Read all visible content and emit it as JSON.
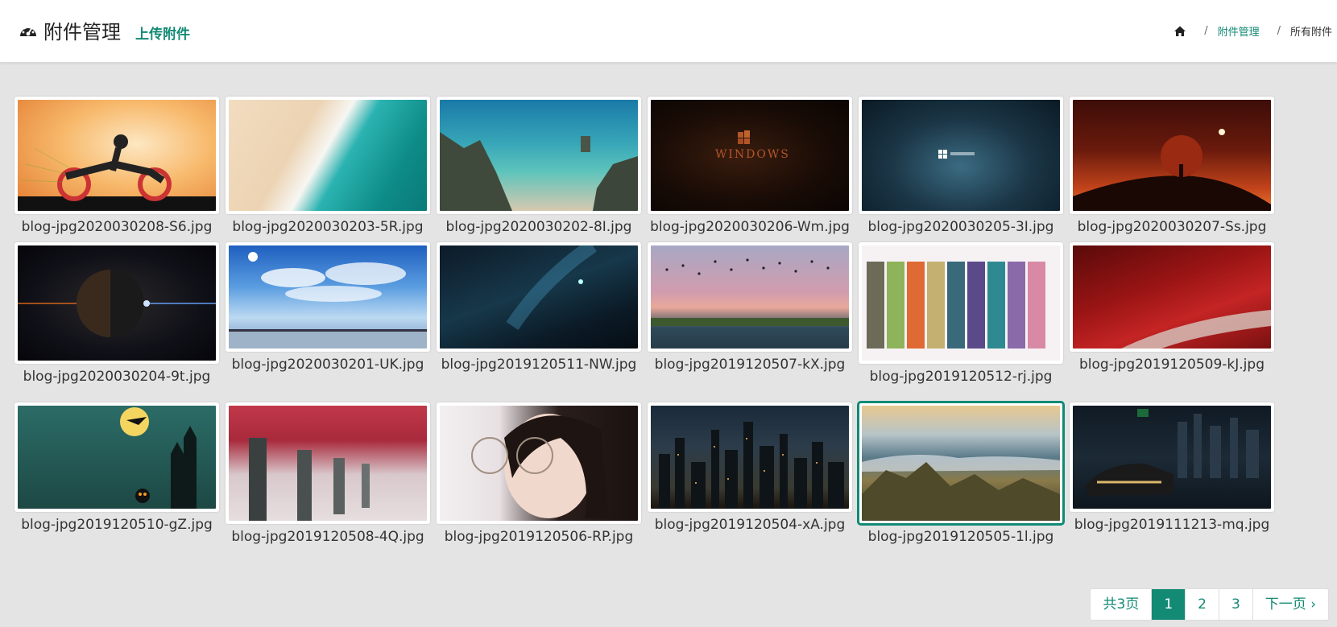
{
  "header": {
    "title": "附件管理",
    "upload_label": "上传附件",
    "breadcrumb": {
      "home_icon": "home-icon",
      "sep": "/",
      "level1": "附件管理",
      "level2": "所有附件"
    }
  },
  "colors": {
    "accent": "#128a74",
    "background": "#e4e4e4"
  },
  "attachments": [
    {
      "name": "blog-jpg2020030208-S6.jpg",
      "subject": "ghost rider on flaming motorcycle"
    },
    {
      "name": "blog-jpg2020030203-5R.jpg",
      "subject": "aerial beach and turquoise sea"
    },
    {
      "name": "blog-jpg2020030202-8I.jpg",
      "subject": "aerial rocky coastline"
    },
    {
      "name": "blog-jpg2020030206-Wm.jpg",
      "subject": "windows logo on dark brown"
    },
    {
      "name": "blog-jpg2020030205-3I.jpg",
      "subject": "windows 10 logo dark blue"
    },
    {
      "name": "blog-jpg2020030207-Ss.jpg",
      "subject": "red tree at sunset"
    },
    {
      "name": "blog-jpg2020030204-9t.jpg",
      "subject": "planet in space"
    },
    {
      "name": "blog-jpg2020030201-UK.jpg",
      "subject": "blue sky with clouds and pier"
    },
    {
      "name": "blog-jpg2019120511-NW.jpg",
      "subject": "deep space nebula"
    },
    {
      "name": "blog-jpg2019120507-kX.jpg",
      "subject": "birds over lake at dusk"
    },
    {
      "name": "blog-jpg2019120512-rj.jpg",
      "subject": "anime characters banner"
    },
    {
      "name": "blog-jpg2019120509-kJ.jpg",
      "subject": "red autumn forest road"
    },
    {
      "name": "blog-jpg2019120510-gZ.jpg",
      "subject": "halloween witch and castle"
    },
    {
      "name": "blog-jpg2019120508-4Q.jpg",
      "subject": "red leaves and trees"
    },
    {
      "name": "blog-jpg2019120506-RP.jpg",
      "subject": "girl with glasses"
    },
    {
      "name": "blog-jpg2019120504-xA.jpg",
      "subject": "futuristic city at night"
    },
    {
      "name": "blog-jpg2019120505-1l.jpg",
      "subject": "mountain peaks above clouds",
      "selected": true
    },
    {
      "name": "blog-jpg2019111213-mq.jpg",
      "subject": "sports car in night city"
    }
  ],
  "pagination": {
    "total_label": "共3页",
    "pages": [
      "1",
      "2",
      "3"
    ],
    "current": "1",
    "next_label": "下一页 ›"
  }
}
